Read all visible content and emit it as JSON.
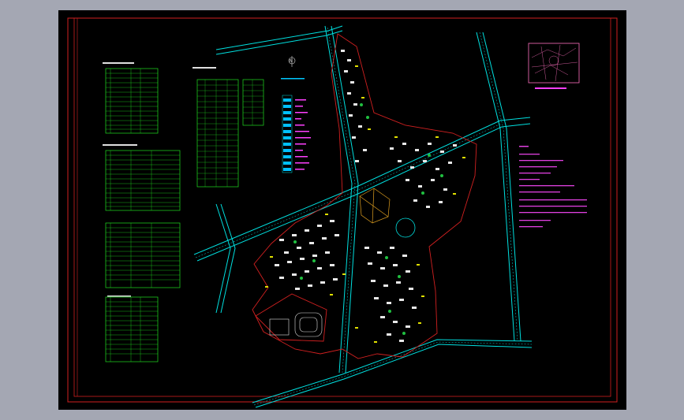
{
  "drawing": {
    "background": "#000000",
    "frame_color": "#d02020",
    "table_color": "#20e020",
    "road_color": "#00e0e0",
    "legend_color": "#ff40ff",
    "key_plan_color": "#ff70c0",
    "notes_color": "#e040e0",
    "north_letter": "N",
    "north_label": "",
    "key_plan_label": "",
    "tables_left": [
      {
        "title": "",
        "rows": 14
      },
      {
        "title": "",
        "rows": 14
      },
      {
        "title": "",
        "rows": 14
      },
      {
        "title": "",
        "rows": 14
      }
    ],
    "tables_mid": [
      {
        "title": "",
        "rows": 20
      },
      {
        "title": "",
        "rows": 8
      }
    ],
    "legend_entries": 12,
    "notes_lines": 11
  }
}
